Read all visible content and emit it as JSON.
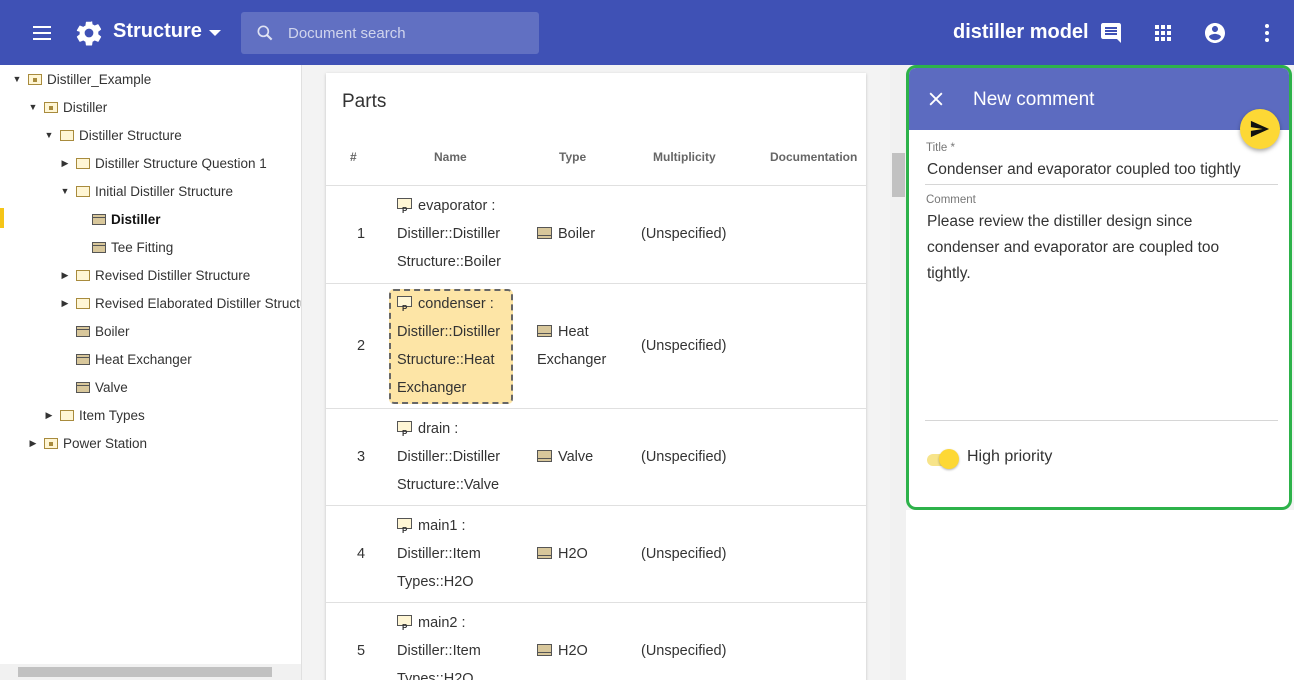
{
  "header": {
    "app_title": "Structure",
    "search_placeholder": "Document search",
    "model_name": "distiller model",
    "bg_color": "#3f51b5"
  },
  "tree": [
    {
      "label": "Distiller_Example",
      "icon": "package-folder-icon",
      "arrow": "▼"
    },
    {
      "label": "Distiller",
      "icon": "package-folder-icon",
      "arrow": "▼"
    },
    {
      "label": "Distiller Structure",
      "icon": "folder-icon",
      "arrow": "▼"
    },
    {
      "label": "Distiller Structure Question 1",
      "icon": "folder-icon",
      "arrow": "▶"
    },
    {
      "label": "Initial Distiller Structure",
      "icon": "folder-icon",
      "arrow": "▼"
    },
    {
      "label": "Distiller",
      "icon": "block-icon",
      "arrow": ""
    },
    {
      "label": "Tee Fitting",
      "icon": "block-icon",
      "arrow": ""
    },
    {
      "label": "Revised Distiller Structure",
      "icon": "folder-icon",
      "arrow": "▶"
    },
    {
      "label": "Revised Elaborated Distiller Structu",
      "icon": "folder-icon",
      "arrow": "▶"
    },
    {
      "label": "Boiler",
      "icon": "block-icon",
      "arrow": ""
    },
    {
      "label": "Heat Exchanger",
      "icon": "block-icon",
      "arrow": ""
    },
    {
      "label": "Valve",
      "icon": "block-icon",
      "arrow": ""
    },
    {
      "label": "Item Types",
      "icon": "folder-icon",
      "arrow": "▶"
    },
    {
      "label": "Power Station",
      "icon": "package-folder-icon",
      "arrow": "▶"
    }
  ],
  "parts": {
    "title": "Parts",
    "columns": [
      "#",
      "Name",
      "Type",
      "Multiplicity",
      "Documentation"
    ],
    "rows": [
      {
        "num": "1",
        "name": [
          "evaporator :",
          "Distiller::Distiller",
          "Structure::Boiler"
        ],
        "type": [
          "Boiler"
        ],
        "multiplicity": "(Unspecified)"
      },
      {
        "num": "2",
        "name": [
          "condenser :",
          "Distiller::Distiller",
          "Structure::Heat",
          "Exchanger"
        ],
        "type": [
          "Heat",
          "Exchanger"
        ],
        "multiplicity": "(Unspecified)"
      },
      {
        "num": "3",
        "name": [
          "drain :",
          "Distiller::Distiller",
          "Structure::Valve"
        ],
        "type": [
          "Valve"
        ],
        "multiplicity": "(Unspecified)"
      },
      {
        "num": "4",
        "name": [
          "main1 :",
          "Distiller::Item",
          "Types::H2O"
        ],
        "type": [
          "H2O"
        ],
        "multiplicity": "(Unspecified)"
      },
      {
        "num": "5",
        "name": [
          "main2 :",
          "Distiller::Item",
          "Types::H2O"
        ],
        "type": [
          "H2O"
        ],
        "multiplicity": "(Unspecified)"
      }
    ]
  },
  "comment": {
    "header": "New comment",
    "title_label": "Title *",
    "title_value": "Condenser and evaporator coupled too tightly",
    "comment_label": "Comment",
    "comment_lines": [
      "Please review the distiller design since",
      "condenser and evaporator are coupled too",
      "tightly."
    ],
    "priority_label": "High priority",
    "priority_on": true,
    "accent": "#fdd835",
    "header_color": "#5c6bc0",
    "outline_color": "#2db24a"
  }
}
